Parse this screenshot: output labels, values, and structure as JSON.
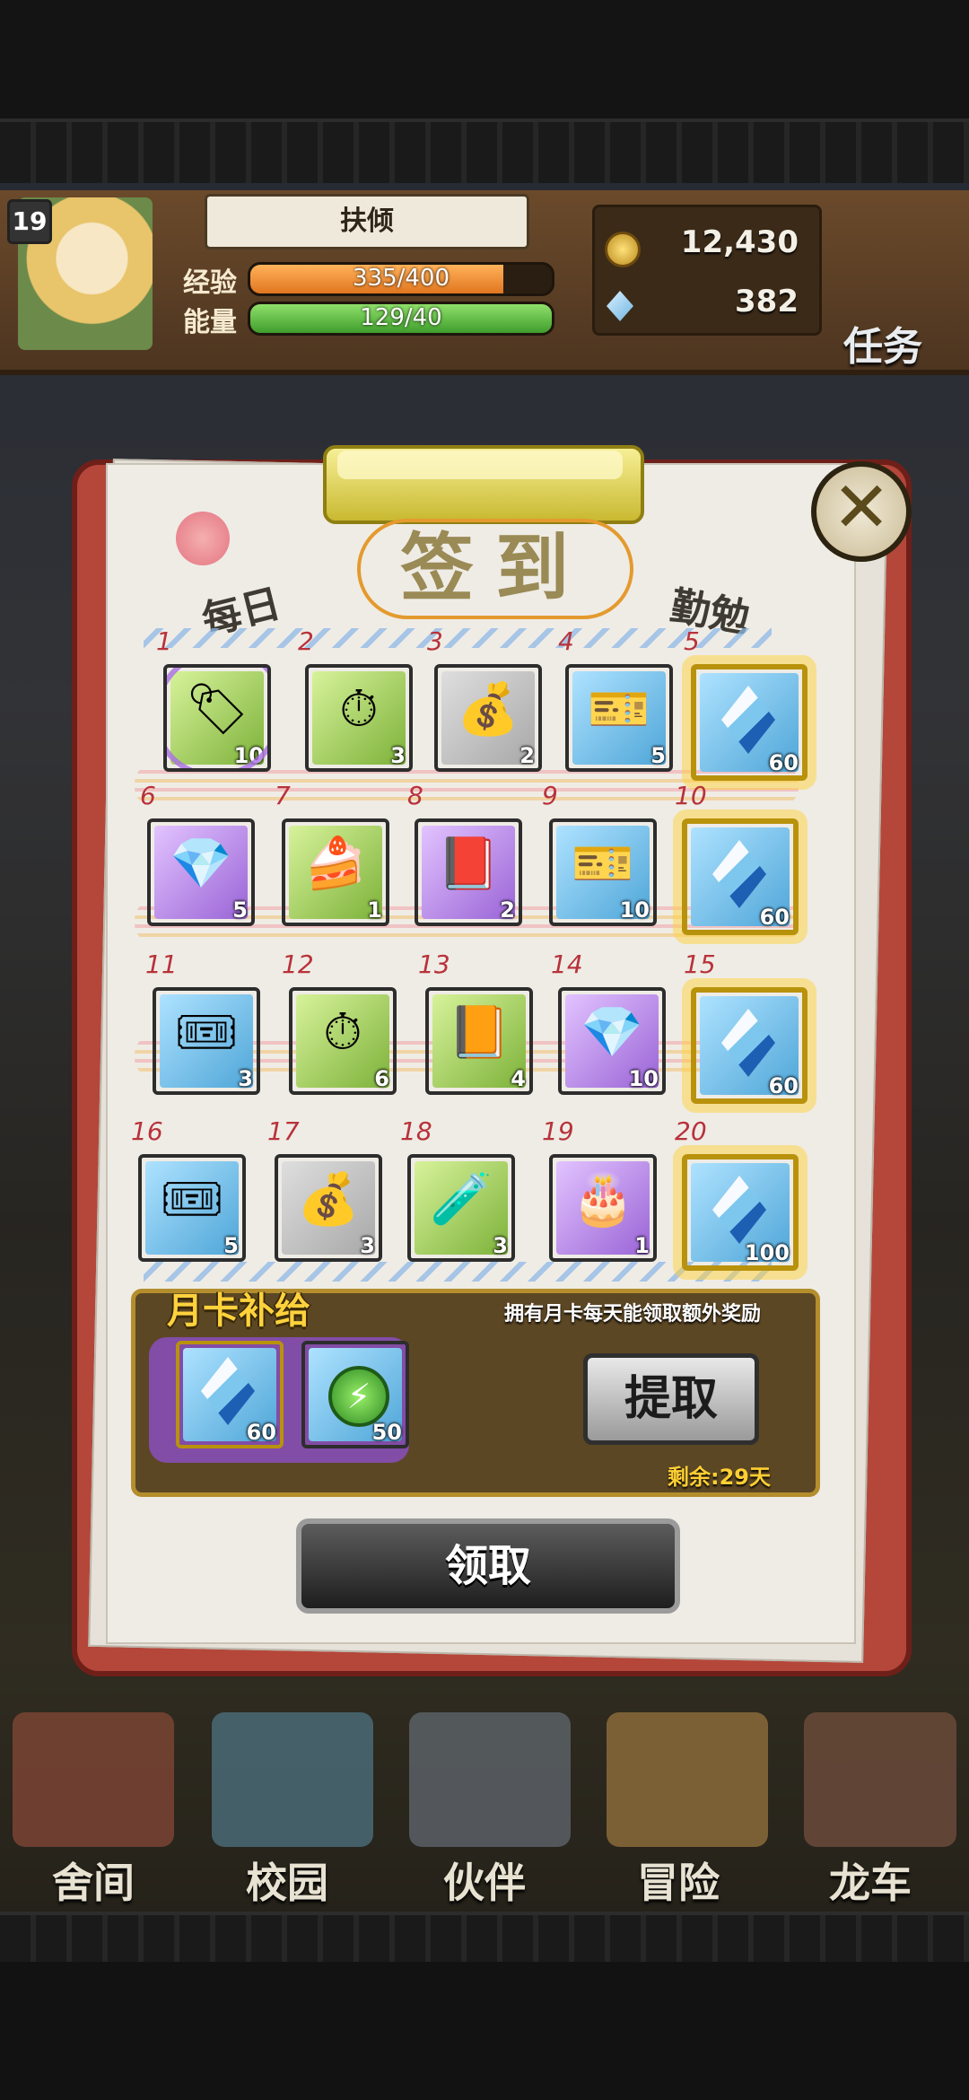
{
  "header": {
    "level": "19",
    "player_name": "扶倾",
    "exp_label": "经验",
    "exp_text": "335/400",
    "exp_fraction": 0.84,
    "energy_label": "能量",
    "energy_text": "129/40",
    "energy_fraction": 1.0,
    "gold": "12,430",
    "gems": "382",
    "task_label": "任务"
  },
  "dialog": {
    "title": "签到",
    "left_word": "每日",
    "right_word": "勤勉",
    "close_symbol": "✕"
  },
  "rewards": [
    {
      "day": "1",
      "count": "10",
      "bg": "bg-green",
      "glyph": "🏷",
      "claimed": true
    },
    {
      "day": "2",
      "count": "3",
      "bg": "bg-green",
      "glyph": "⏱",
      "claimed": false
    },
    {
      "day": "3",
      "count": "2",
      "bg": "bg-gray",
      "glyph": "💰",
      "claimed": false
    },
    {
      "day": "4",
      "count": "5",
      "bg": "bg-blue",
      "glyph": "🎫",
      "claimed": false
    },
    {
      "day": "5",
      "count": "60",
      "bg": "bg-blue",
      "glyph": "",
      "gem": true,
      "claimed": false
    },
    {
      "day": "6",
      "count": "5",
      "bg": "bg-purple",
      "glyph": "💎",
      "claimed": false
    },
    {
      "day": "7",
      "count": "1",
      "bg": "bg-green",
      "glyph": "🍰",
      "claimed": false
    },
    {
      "day": "8",
      "count": "2",
      "bg": "bg-purple",
      "glyph": "📕",
      "claimed": false
    },
    {
      "day": "9",
      "count": "10",
      "bg": "bg-blue",
      "glyph": "🎫",
      "claimed": false
    },
    {
      "day": "10",
      "count": "60",
      "bg": "bg-blue",
      "glyph": "",
      "gem": true,
      "claimed": false
    },
    {
      "day": "11",
      "count": "3",
      "bg": "bg-blue",
      "glyph": "🎟",
      "claimed": false
    },
    {
      "day": "12",
      "count": "6",
      "bg": "bg-green",
      "glyph": "⏱",
      "claimed": false
    },
    {
      "day": "13",
      "count": "4",
      "bg": "bg-green",
      "glyph": "📙",
      "claimed": false
    },
    {
      "day": "14",
      "count": "10",
      "bg": "bg-purple",
      "glyph": "💎",
      "claimed": false
    },
    {
      "day": "15",
      "count": "60",
      "bg": "bg-blue",
      "glyph": "",
      "gem": true,
      "claimed": false
    },
    {
      "day": "16",
      "count": "5",
      "bg": "bg-blue",
      "glyph": "🎟",
      "claimed": false
    },
    {
      "day": "17",
      "count": "3",
      "bg": "bg-gray",
      "glyph": "💰",
      "claimed": false
    },
    {
      "day": "18",
      "count": "3",
      "bg": "bg-green",
      "glyph": "🧪",
      "claimed": false
    },
    {
      "day": "19",
      "count": "1",
      "bg": "bg-purple",
      "glyph": "🎂",
      "claimed": false
    },
    {
      "day": "20",
      "count": "100",
      "bg": "bg-blue",
      "glyph": "",
      "gem": true,
      "claimed": false
    }
  ],
  "monthly_card": {
    "title": "月卡补给",
    "hint": "拥有月卡每天能领取额外奖励",
    "items": [
      {
        "count": "60",
        "icon": "gem"
      },
      {
        "count": "50",
        "icon": "energy"
      }
    ],
    "extract_button": "提取",
    "remaining": "剩余:29天"
  },
  "claim_button": "领取",
  "bottom_nav": [
    "舍间",
    "校园",
    "伙伴",
    "冒险",
    "龙车"
  ]
}
